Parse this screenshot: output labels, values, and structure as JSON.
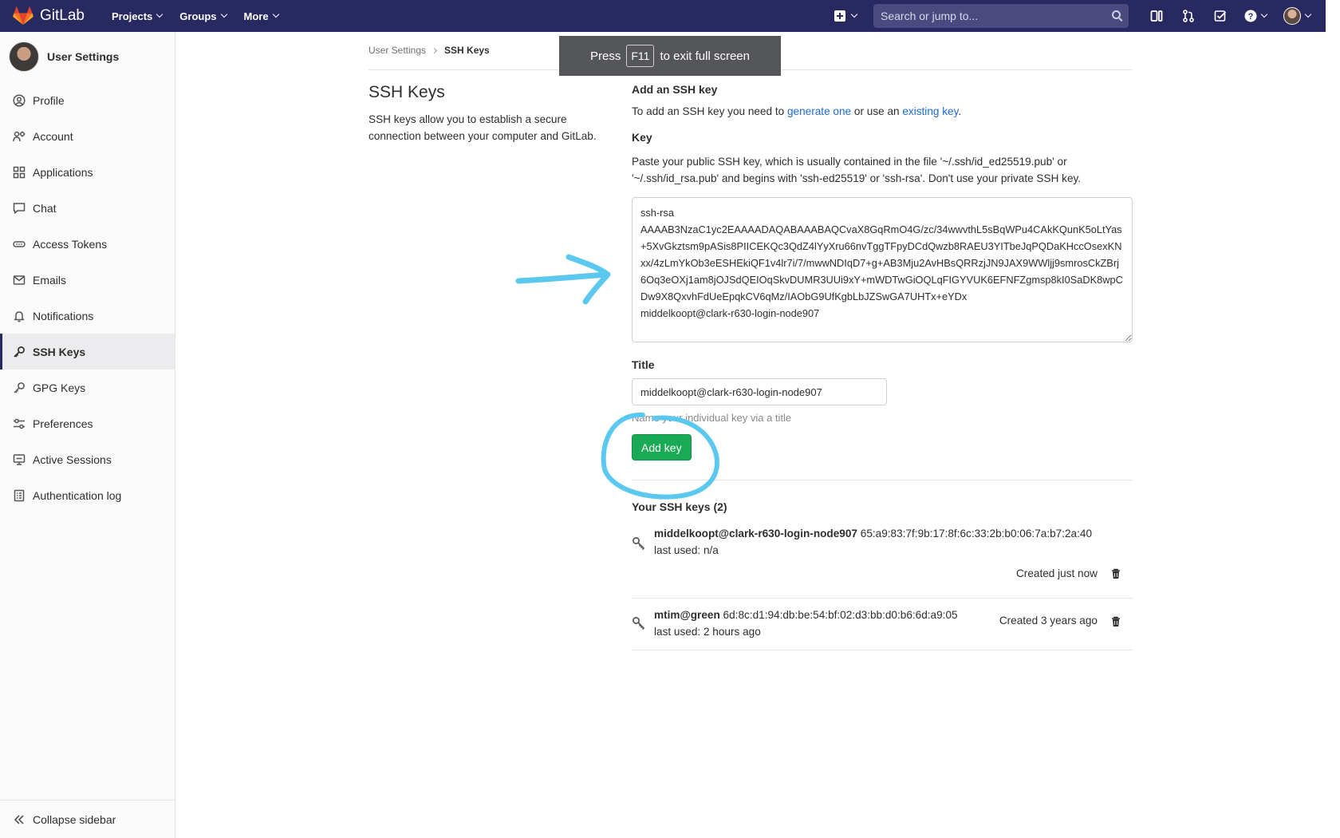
{
  "navbar": {
    "brand": "GitLab",
    "menu": [
      "Projects",
      "Groups",
      "More"
    ],
    "search_placeholder": "Search or jump to..."
  },
  "sidebar": {
    "title": "User Settings",
    "items": [
      {
        "label": "Profile",
        "icon": "profile-icon"
      },
      {
        "label": "Account",
        "icon": "account-icon"
      },
      {
        "label": "Applications",
        "icon": "applications-icon"
      },
      {
        "label": "Chat",
        "icon": "chat-icon"
      },
      {
        "label": "Access Tokens",
        "icon": "access-tokens-icon"
      },
      {
        "label": "Emails",
        "icon": "email-icon"
      },
      {
        "label": "Notifications",
        "icon": "bell-icon"
      },
      {
        "label": "SSH Keys",
        "icon": "key-icon",
        "active": true
      },
      {
        "label": "GPG Keys",
        "icon": "key-icon"
      },
      {
        "label": "Preferences",
        "icon": "preferences-icon"
      },
      {
        "label": "Active Sessions",
        "icon": "monitor-icon"
      },
      {
        "label": "Authentication log",
        "icon": "log-icon"
      }
    ],
    "collapse_label": "Collapse sidebar"
  },
  "toast": {
    "before": "Press",
    "key": "F11",
    "after": "to exit full screen"
  },
  "breadcrumb": {
    "parent": "User Settings",
    "current": "SSH Keys"
  },
  "intro": {
    "title": "SSH Keys",
    "description": "SSH keys allow you to establish a secure connection between your computer and GitLab."
  },
  "form": {
    "heading": "Add an SSH key",
    "add_text_before": "To add an SSH key you need to",
    "generate_link": "generate one",
    "add_text_middle": "or use an",
    "existing_link": "existing key",
    "add_text_after": ".",
    "key_label": "Key",
    "key_help": "Paste your public SSH key, which is usually contained in the file '~/.ssh/id_ed25519.pub' or '~/.ssh/id_rsa.pub' and begins with 'ssh-ed25519' or 'ssh-rsa'. Don't use your private SSH key.",
    "key_value": "ssh-rsa\nAAAAB3NzaC1yc2EAAAADAQABAAABAQCvaX8GqRmO4G/zc/34wwvthL5sBqWPu4CAkKQunK5oLtYas+5XvGkztsm9pASis8PIICEKQc3QdZ4lYyXru66nvTggTFpyDCdQwzb8RAEU3YITbeJqPQDaKHccOsexKNxx/4zLmYkOb3eESHEkiQF1v4lr7i/7/mwwNDIqD7+g+AB3Mju2AvHBsQRRzjJN9JAX9WWljj9smrosCkZBrj6Oq3eOXj1am8jOJSdQEIOqSkvDUMR3UUi9xY+mWDTwGiOQLqFIGYVUK6EFNFZgmsp8kI0SaDK8wpCDw9X8QxvhFdUeEpqkCV6qMz/IAObG9UfKgbLbJZSwGA7UHTx+eYDx\nmiddelkoopt@clark-r630-login-node907",
    "title_label": "Title",
    "title_value": "middelkoopt@clark-r630-login-node907",
    "title_hint": "Name your individual key via a title",
    "add_button": "Add key"
  },
  "keys": {
    "heading": "Your SSH keys (2)",
    "items": [
      {
        "name": "middelkoopt@clark-r630-login-node907",
        "fingerprint": "65:a9:83:7f:9b:17:8f:6c:33:2b:b0:06:7a:b7:2a:40",
        "last_used": "last used: n/a",
        "created": "Created just now"
      },
      {
        "name": "mtim@green",
        "fingerprint": "6d:8c:d1:94:db:be:54:bf:02:d3:bb:d0:b6:6d:a9:05",
        "last_used": "last used: 2 hours ago",
        "created": "Created 3 years ago"
      }
    ]
  },
  "colors": {
    "navbar": "#292961",
    "primary_button": "#1aaa55",
    "link": "#1f6bcf",
    "annotation": "#5bc8f0"
  }
}
